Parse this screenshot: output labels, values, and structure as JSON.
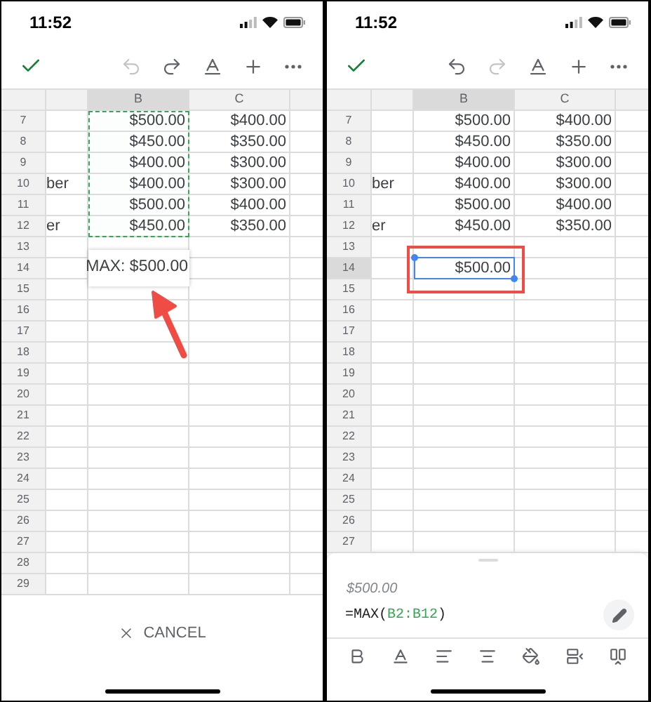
{
  "phones": [
    {
      "status_time": "11:52",
      "toolbar": [
        {
          "kind": "confirm"
        },
        {
          "kind": "undo",
          "disabled": true
        },
        {
          "kind": "redo",
          "disabled": false
        },
        {
          "kind": "format",
          "disabled": false
        },
        {
          "kind": "insert",
          "disabled": false
        },
        {
          "kind": "more",
          "disabled": false
        }
      ],
      "columns": [
        {
          "label": "B",
          "selected": true
        },
        {
          "label": "C",
          "selected": false
        }
      ],
      "rows": [
        {
          "number": "7",
          "b": "$500.00",
          "c": "$400.00",
          "selected": false,
          "in_range": true
        },
        {
          "number": "8",
          "b": "$450.00",
          "c": "$350.00",
          "selected": false,
          "in_range": true
        },
        {
          "number": "9",
          "b": "$400.00",
          "c": "$300.00",
          "selected": false,
          "in_range": true
        },
        {
          "number": "10",
          "a": "ber",
          "b": "$400.00",
          "c": "$300.00",
          "selected": false,
          "in_range": true
        },
        {
          "number": "11",
          "b": "$500.00",
          "c": "$400.00",
          "selected": false,
          "in_range": true
        },
        {
          "number": "12",
          "a": "er",
          "b": "$450.00",
          "c": "$350.00",
          "selected": false,
          "in_range": true
        },
        {
          "number": "13",
          "selected": false,
          "in_range": false
        },
        {
          "number": "14",
          "editor": "MAX: $500.00",
          "selected": false,
          "in_range": false
        },
        {
          "number": "15",
          "selected": false,
          "in_range": false
        },
        {
          "number": "16",
          "selected": false,
          "in_range": false
        },
        {
          "number": "17",
          "selected": false,
          "in_range": false
        },
        {
          "number": "18",
          "selected": false,
          "in_range": false
        },
        {
          "number": "19",
          "selected": false,
          "in_range": false
        },
        {
          "number": "20",
          "selected": false,
          "in_range": false
        },
        {
          "number": "21",
          "selected": false,
          "in_range": false
        },
        {
          "number": "22",
          "selected": false,
          "in_range": false
        },
        {
          "number": "23",
          "selected": false,
          "in_range": false
        },
        {
          "number": "24",
          "selected": false,
          "in_range": false
        },
        {
          "number": "25",
          "selected": false,
          "in_range": false
        },
        {
          "number": "26",
          "selected": false,
          "in_range": false
        },
        {
          "number": "27",
          "selected": false,
          "in_range": false
        },
        {
          "number": "28",
          "selected": false,
          "in_range": false
        },
        {
          "number": "29",
          "selected": false,
          "in_range": false
        }
      ],
      "footer": {
        "kind": "cancel",
        "label": "CANCEL"
      }
    },
    {
      "status_time": "11:52",
      "toolbar": [
        {
          "kind": "confirm"
        },
        {
          "kind": "undo",
          "disabled": false
        },
        {
          "kind": "redo",
          "disabled": true
        },
        {
          "kind": "format",
          "disabled": false
        },
        {
          "kind": "insert",
          "disabled": false
        },
        {
          "kind": "more",
          "disabled": false
        }
      ],
      "columns": [
        {
          "label": "B",
          "selected": true
        },
        {
          "label": "C",
          "selected": false
        }
      ],
      "rows": [
        {
          "number": "7",
          "b": "$500.00",
          "c": "$400.00",
          "selected": false,
          "in_range": false
        },
        {
          "number": "8",
          "b": "$450.00",
          "c": "$350.00",
          "selected": false,
          "in_range": false
        },
        {
          "number": "9",
          "b": "$400.00",
          "c": "$300.00",
          "selected": false,
          "in_range": false
        },
        {
          "number": "10",
          "a": "ber",
          "b": "$400.00",
          "c": "$300.00",
          "selected": false,
          "in_range": false
        },
        {
          "number": "11",
          "b": "$500.00",
          "c": "$400.00",
          "selected": false,
          "in_range": false
        },
        {
          "number": "12",
          "a": "er",
          "b": "$450.00",
          "c": "$350.00",
          "selected": false,
          "in_range": false
        },
        {
          "number": "13",
          "selected": false,
          "in_range": false
        },
        {
          "number": "14",
          "b": "$500.00",
          "selected": true,
          "in_range": false
        },
        {
          "number": "15",
          "selected": false,
          "in_range": false
        },
        {
          "number": "16",
          "selected": false,
          "in_range": false
        },
        {
          "number": "17",
          "selected": false,
          "in_range": false
        },
        {
          "number": "18",
          "selected": false,
          "in_range": false
        },
        {
          "number": "19",
          "selected": false,
          "in_range": false
        },
        {
          "number": "20",
          "selected": false,
          "in_range": false
        },
        {
          "number": "21",
          "selected": false,
          "in_range": false
        },
        {
          "number": "22",
          "selected": false,
          "in_range": false
        },
        {
          "number": "23",
          "selected": false,
          "in_range": false
        },
        {
          "number": "24",
          "selected": false,
          "in_range": false
        },
        {
          "number": "25",
          "selected": false,
          "in_range": false
        },
        {
          "number": "26",
          "selected": false,
          "in_range": false
        },
        {
          "number": "27",
          "selected": false,
          "in_range": false
        }
      ],
      "footer": {
        "kind": "sheet",
        "value": "$500.00",
        "formula_start": "=MAX(",
        "formula_range": "B2:B12",
        "formula_end": ")",
        "tools": [
          {
            "kind": "bold"
          },
          {
            "kind": "text-color"
          },
          {
            "kind": "align-left"
          },
          {
            "kind": "align-center"
          },
          {
            "kind": "fill"
          },
          {
            "kind": "insert-row"
          },
          {
            "kind": "insert-column"
          }
        ]
      }
    }
  ]
}
